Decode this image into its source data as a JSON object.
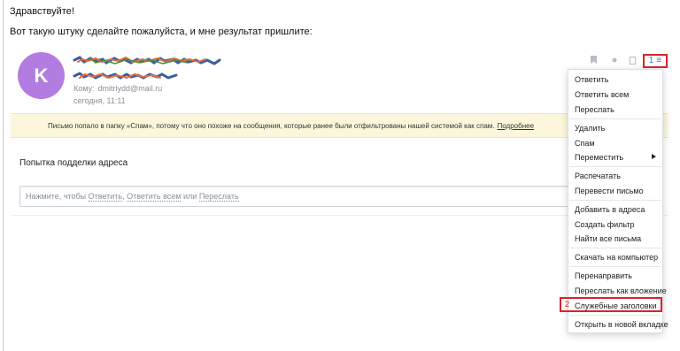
{
  "message": {
    "greeting": "Здравствуйте!",
    "request": "Вот такую штуку сделайте пожалуйста, и мне результат пришлите:"
  },
  "email": {
    "avatar_letter": "K",
    "avatar_color": "#b37ce0",
    "to_label": "Кому:",
    "to_value": "dmitriydd@mail.ru",
    "date": "сегодня, 11:11",
    "subject": "Попытка подделки адреса"
  },
  "header_icons": [
    "bookmark-icon",
    "dot-icon",
    "square-icon"
  ],
  "more_button": {
    "step_number": "1",
    "icon": "≡"
  },
  "spam_banner": {
    "text": "Письмо попало в папку «Спам», потому что оно похоже на сообщения, которые ранее были отфильтрованы нашей системой как спам.",
    "link": "Подробнее",
    "background": "#fcf7dc"
  },
  "reply_box": {
    "prefix": "Нажмите, чтобы",
    "reply": "Ответить",
    "reply_all": "Ответить всем",
    "or": "или",
    "forward": "Переслать"
  },
  "menu": {
    "items": [
      "Ответить",
      "Ответить всем",
      "Переслать",
      "Удалить",
      "Спам",
      "Переместить",
      "Распечатать",
      "Перевести письмо",
      "Добавить в адреса",
      "Создать фильтр",
      "Найти все письма",
      "Скачать на компьютер",
      "Перенаправить",
      "Переслать как вложение",
      "Служебные заголовки",
      "Открыть в новой вкладке"
    ],
    "highlight_step_number": "2"
  },
  "accent_colors": {
    "annotation_red": "#d9232d",
    "link_blue": "#3a74c2"
  }
}
